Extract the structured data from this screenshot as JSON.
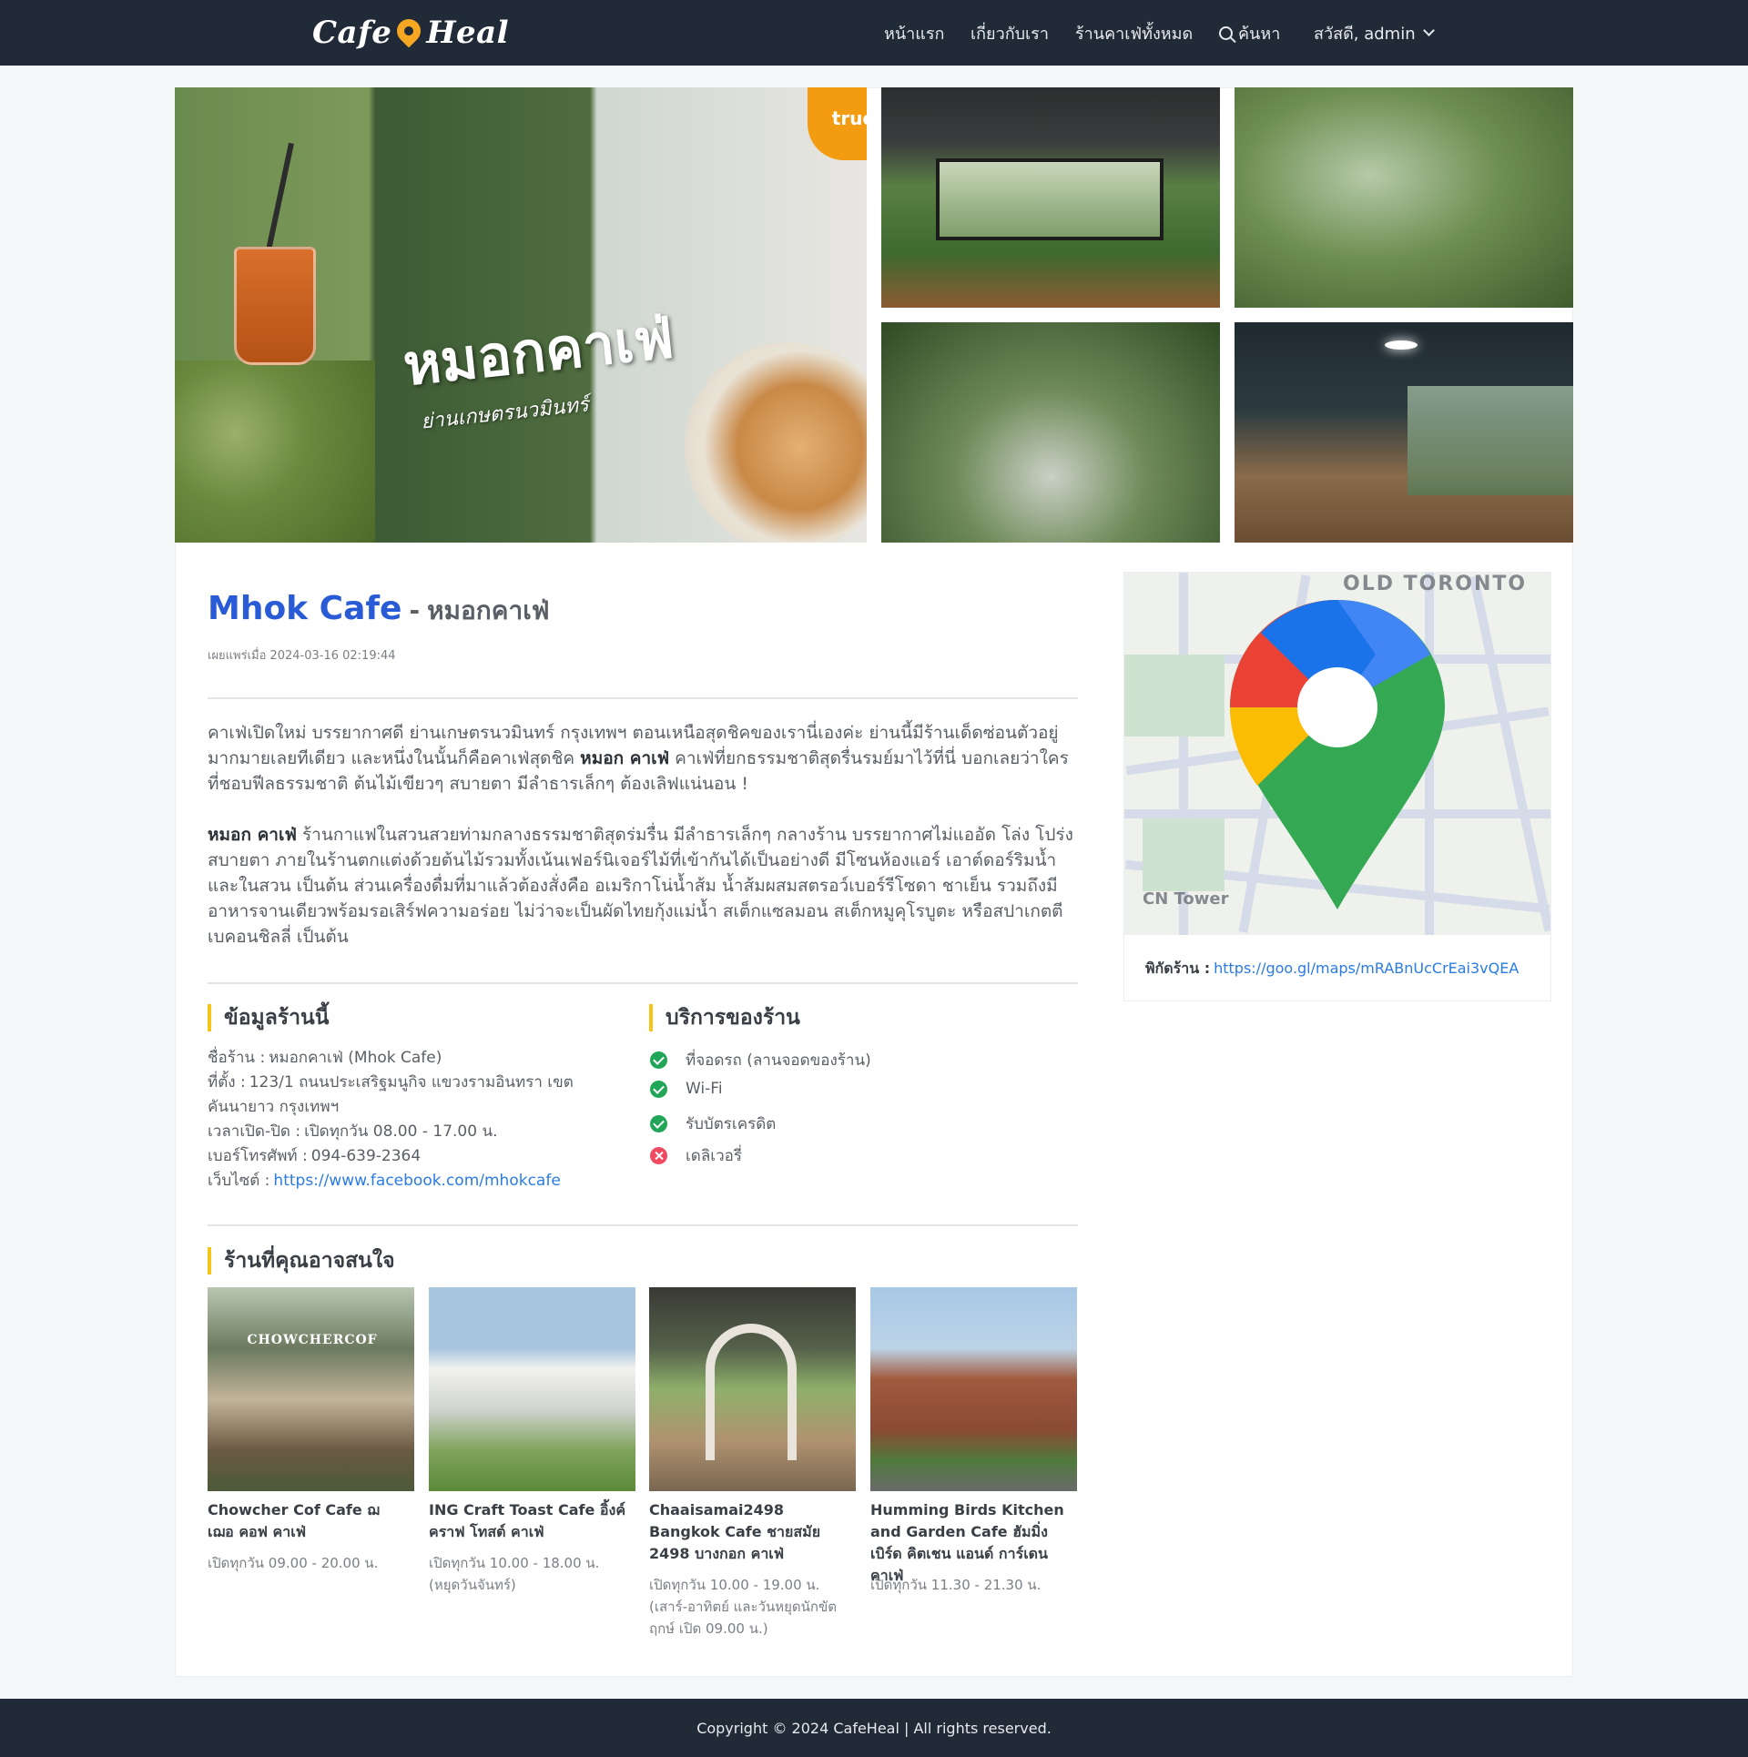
{
  "nav": {
    "logo": "Cafe Heal",
    "items": [
      {
        "label": "หน้าแรก"
      },
      {
        "label": "เกี่ยวกับเรา"
      },
      {
        "label": "ร้านคาเฟ่ทั้งหมด"
      },
      {
        "label": "ค้นหา"
      }
    ],
    "user_greeting": "สวัสดี, admin"
  },
  "gallery": {
    "main_promo_title": "หมอกคาเฟ่",
    "main_promo_sub": "ย่านเกษตรนวมินทร์",
    "main_badge": "true"
  },
  "cafe": {
    "name_en": "Mhok Cafe",
    "separator": "-",
    "name_th": "หมอกคาเฟ่",
    "published_label": "เผยแพร่เมื่อ",
    "published_at": "2024-03-16 02:19:44"
  },
  "description": {
    "p1_a": "คาเฟ่เปิดใหม่ บรรยากาศดี ย่านเกษตรนวมินทร์ กรุงเทพฯ ตอนเหนือสุดชิคของเรานี่เองค่ะ ย่านนี้มีร้านเด็ดซ่อนตัวอยู่มากมายเลยทีเดียว และหนึ่งในนั้นก็คือคาเฟ่สุดชิค",
    "p1_bold": "หมอก คาเฟ่",
    "p1_b": "คาเฟ่ที่ยกธรรมชาติสุดรื่นรมย์มาไว้ที่นี่ บอกเลยว่าใครที่ชอบฟีลธรรมชาติ ต้นไม้เขียวๆ สบายตา มีลำธารเล็กๆ ต้องเลิฟแน่นอน !",
    "p2_bold": "หมอก คาเฟ่",
    "p2": "ร้านกาแฟในสวนสวยท่ามกลางธรรมชาติสุดร่มรื่น มีลำธารเล็กๆ กลางร้าน บรรยากาศไม่แออัด โล่ง โปร่ง สบายตา ภายในร้านตกแต่งด้วยต้นไม้รวมทั้งเน้นเฟอร์นิเจอร์ไม้ที่เข้ากันได้เป็นอย่างดี มีโซนห้องแอร์ เอาต์ดอร์ริมน้ำ และในสวน เป็นต้น ส่วนเครื่องดื่มที่มาแล้วต้องสั่งคือ อเมริกาโน่น้ำส้ม น้ำส้มผสมสตรอว์เบอร์รีโซดา ชาเย็น รวมถึงมีอาหารจานเดียวพร้อมรอเสิร์ฟความอร่อย ไม่ว่าจะเป็นผัดไทยกุ้งแม่น้ำ สเต็กแซลมอน สเต็กหมูคุโรบูตะ หรือสปาเกตตีเบคอนชิลลี่ เป็นต้น"
  },
  "info": {
    "heading": "ข้อมูลร้านนี้",
    "name_label": "ชื่อร้าน :",
    "name": "หมอกคาเฟ่ (Mhok Cafe)",
    "address_label": "ที่ตั้ง :",
    "address": "123/1 ถนนประเสริฐมนูกิจ แขวงรามอินทรา เขตคันนายาว กรุงเทพฯ",
    "hours_label": "เวลาเปิด-ปิด :",
    "hours": "เปิดทุกวัน 08.00 - 17.00 น.",
    "phone_label": "เบอร์โทรศัพท์ :",
    "phone": "094-639-2364",
    "website_label": "เว็บไซต์ :",
    "website": "https://www.facebook.com/mhokcafe"
  },
  "services": {
    "heading": "บริการของร้าน",
    "items": [
      {
        "label": "ที่จอดรถ (ลานจอดของร้าน)",
        "available": true
      },
      {
        "label": "Wi-Fi",
        "available": true
      },
      {
        "label": "รับบัตรเครดิต",
        "available": true
      },
      {
        "label": "เดลิเวอรี่",
        "available": false
      }
    ]
  },
  "related": {
    "heading": "ร้านที่คุณอาจสนใจ",
    "items": [
      {
        "name": "Chowcher Cof Cafe ฌ เฌอ คอฟ คาเฟ่",
        "hours": "เปิดทุกวัน 09.00 - 20.00 น.",
        "sign": "CHOWCHERCOF"
      },
      {
        "name": "ING Craft Toast Cafe อิ้งค์ คราฟ โทสต์ คาเฟ่",
        "hours": "เปิดทุกวัน 10.00 - 18.00 น. (หยุดวันจันทร์)"
      },
      {
        "name": "Chaaisamai2498 Bangkok Cafe ชายสมัย 2498 บางกอก คาเฟ่",
        "hours": "เปิดทุกวัน 10.00 - 19.00 น. (เสาร์-อาทิตย์ และวันหยุดนักขัตฤกษ์ เปิด 09.00 น.)"
      },
      {
        "name": "Humming Birds Kitchen and Garden Cafe ฮัมมิ่งเบิร์ด คิตเชน แอนด์ การ์เดน คาเฟ่",
        "hours": "เปิดทุกวัน 11.30 - 21.30 น."
      }
    ]
  },
  "map": {
    "label_old_toronto": "OLD TORONTO",
    "label_cn_tower": "CN Tower",
    "coord_label": "พิกัดร้าน :",
    "coord_link": "https://goo.gl/maps/mRABnUcCrEai3vQEA"
  },
  "footer": {
    "copyright": "Copyright © 2024 CafeHeal | All rights reserved."
  }
}
